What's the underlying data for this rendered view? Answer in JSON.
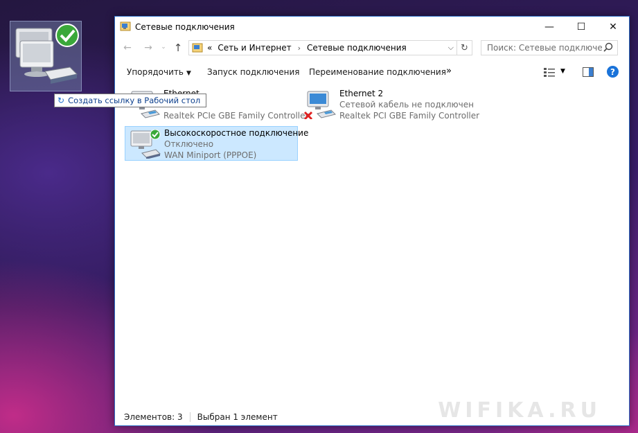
{
  "desktop": {
    "drag_tooltip": "Создать ссылку в Рабочий стол"
  },
  "window": {
    "title": "Сетевые подключения",
    "controls": {
      "minimize": "—",
      "maximize": "☐",
      "close": "✕"
    }
  },
  "navigation": {
    "back": "←",
    "forward": "→",
    "recent": "⌄",
    "up": "↑",
    "address": {
      "overflow": "«",
      "segments": [
        "Сеть и Интернет",
        "Сетевые подключения"
      ],
      "separator": "›"
    },
    "search_placeholder": "Поиск: Сетевые подключения"
  },
  "command_bar": {
    "organize": "Упорядочить",
    "start_connection": "Запуск подключения",
    "rename_connection": "Переименование подключения",
    "more": "»",
    "help": "?"
  },
  "connections": [
    {
      "name": "Ethernet",
      "status": "",
      "adapter": "Realtek PCIe GBE Family Controller",
      "state": "connected"
    },
    {
      "name": "Ethernet 2",
      "status": "Сетевой кабель не подключен",
      "adapter": "Realtek PCI GBE Family Controller",
      "state": "unplugged"
    },
    {
      "name": "Высокоскоростное подключение",
      "status": "Отключено",
      "adapter": "WAN Miniport (PPPOE)",
      "state": "disconnected",
      "selected": true
    }
  ],
  "status_bar": {
    "item_count": "Элементов: 3",
    "selection": "Выбран 1 элемент"
  },
  "watermark": "WIFIKA.RU",
  "colors": {
    "selection_bg": "#cce8ff",
    "selection_border": "#99d1ff",
    "window_border": "#2b6cc4",
    "help_blue": "#1a73d9",
    "error_red": "#e02020",
    "ok_green": "#3aa83a"
  }
}
